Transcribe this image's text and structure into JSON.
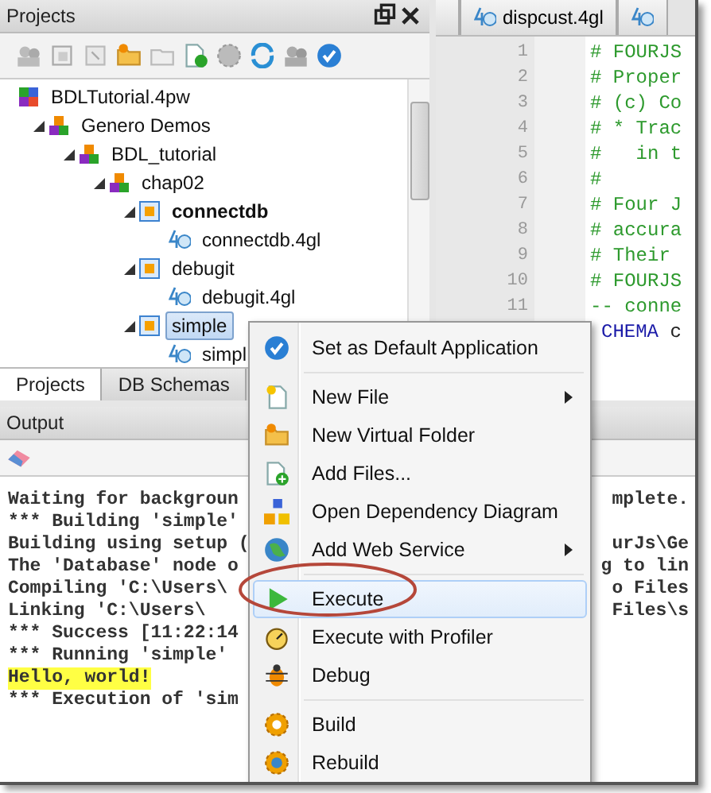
{
  "projects_panel": {
    "title": "Projects",
    "tree": [
      {
        "label": "BDLTutorial.4pw",
        "kind": "workspace",
        "selected": false,
        "children": [
          {
            "label": "Genero Demos",
            "kind": "group",
            "selected": false,
            "expanded": true,
            "children": [
              {
                "label": "BDL_tutorial",
                "kind": "group",
                "selected": false,
                "expanded": true,
                "children": [
                  {
                    "label": "chap02",
                    "kind": "group",
                    "selected": false,
                    "expanded": true,
                    "children": [
                      {
                        "label": "connectdb",
                        "kind": "app",
                        "selected": false,
                        "expanded": true,
                        "is_default": true,
                        "children": [
                          {
                            "label": "connectdb.4gl",
                            "kind": "file",
                            "selected": false
                          }
                        ]
                      },
                      {
                        "label": "debugit",
                        "kind": "app",
                        "selected": false,
                        "expanded": true,
                        "is_default": false,
                        "children": [
                          {
                            "label": "debugit.4gl",
                            "kind": "file",
                            "selected": false
                          }
                        ]
                      },
                      {
                        "label": "simple",
                        "kind": "app",
                        "selected": true,
                        "expanded": true,
                        "is_default": false,
                        "children": [
                          {
                            "label": "simpl",
                            "kind": "file",
                            "selected": false
                          }
                        ]
                      }
                    ]
                  }
                ]
              }
            ]
          }
        ]
      }
    ],
    "tabs": [
      {
        "label": "Projects",
        "selected": true
      },
      {
        "label": "DB Schemas",
        "selected": false
      }
    ]
  },
  "editor": {
    "tabs": [
      {
        "label": "dispcust.4gl",
        "selected": false
      }
    ],
    "lines": [
      {
        "number": "1",
        "code": "# FOURJS",
        "kind": "comment"
      },
      {
        "number": "2",
        "code": "# Proper",
        "kind": "comment"
      },
      {
        "number": "3",
        "code": "# (c) Co",
        "kind": "comment"
      },
      {
        "number": "4",
        "code": "# * Trac",
        "kind": "comment"
      },
      {
        "number": "5",
        "code": "#   in t",
        "kind": "comment"
      },
      {
        "number": "6",
        "code": "#",
        "kind": "comment"
      },
      {
        "number": "7",
        "code": "# Four J",
        "kind": "comment"
      },
      {
        "number": "8",
        "code": "# accura",
        "kind": "comment"
      },
      {
        "number": "9",
        "code": "# Their",
        "kind": "comment"
      },
      {
        "number": "10",
        "code": "# FOURJS",
        "kind": "comment"
      },
      {
        "number": "11",
        "code": "-- conne",
        "kind": "comment"
      },
      {
        "code": "CHEMA",
        "kind": "keyword",
        "rest": "c"
      }
    ]
  },
  "output_panel": {
    "title": "Output",
    "lines": [
      {
        "left": "Waiting for backgroun",
        "right": "mplete.",
        "highlighted": false
      },
      {
        "left": "*** Building 'simple'",
        "highlighted": false
      },
      {
        "left": "Building using setup (",
        "right": "urJs\\Ge",
        "highlighted": false
      },
      {
        "left": "The 'Database' node o",
        "right": "g to lin",
        "highlighted": false
      },
      {
        "left": "Compiling 'C:\\Users\\",
        "right": "o Files",
        "highlighted": false
      },
      {
        "left": "Linking 'C:\\Users\\",
        "right": "Files\\s",
        "highlighted": false
      },
      {
        "left": "*** Success [11:22:14",
        "highlighted": false
      },
      {
        "left": "*** Running 'simple'",
        "highlighted": false
      },
      {
        "left": "Hello, world!",
        "highlighted": true
      },
      {
        "left": "*** Execution of 'sim",
        "highlighted": false
      }
    ]
  },
  "context_menu": {
    "items": [
      {
        "kind": "item",
        "label": "Set as Default Application",
        "submenu": false,
        "selected": false
      },
      {
        "kind": "separator"
      },
      {
        "kind": "item",
        "label": "New File",
        "submenu": true,
        "selected": false
      },
      {
        "kind": "item",
        "label": "New Virtual Folder",
        "submenu": false,
        "selected": false
      },
      {
        "kind": "item",
        "label": "Add Files...",
        "submenu": false,
        "selected": false
      },
      {
        "kind": "item",
        "label": "Open Dependency Diagram",
        "submenu": false,
        "selected": false
      },
      {
        "kind": "item",
        "label": "Add Web Service",
        "submenu": true,
        "selected": false
      },
      {
        "kind": "separator"
      },
      {
        "kind": "item",
        "label": "Execute",
        "submenu": false,
        "selected": true,
        "circled": true
      },
      {
        "kind": "item",
        "label": "Execute with Profiler",
        "submenu": false,
        "selected": false
      },
      {
        "kind": "item",
        "label": "Debug",
        "submenu": false,
        "selected": false
      },
      {
        "kind": "separator"
      },
      {
        "kind": "item",
        "label": "Build",
        "submenu": false,
        "selected": false
      },
      {
        "kind": "item",
        "label": "Rebuild",
        "submenu": false,
        "selected": false
      }
    ]
  }
}
